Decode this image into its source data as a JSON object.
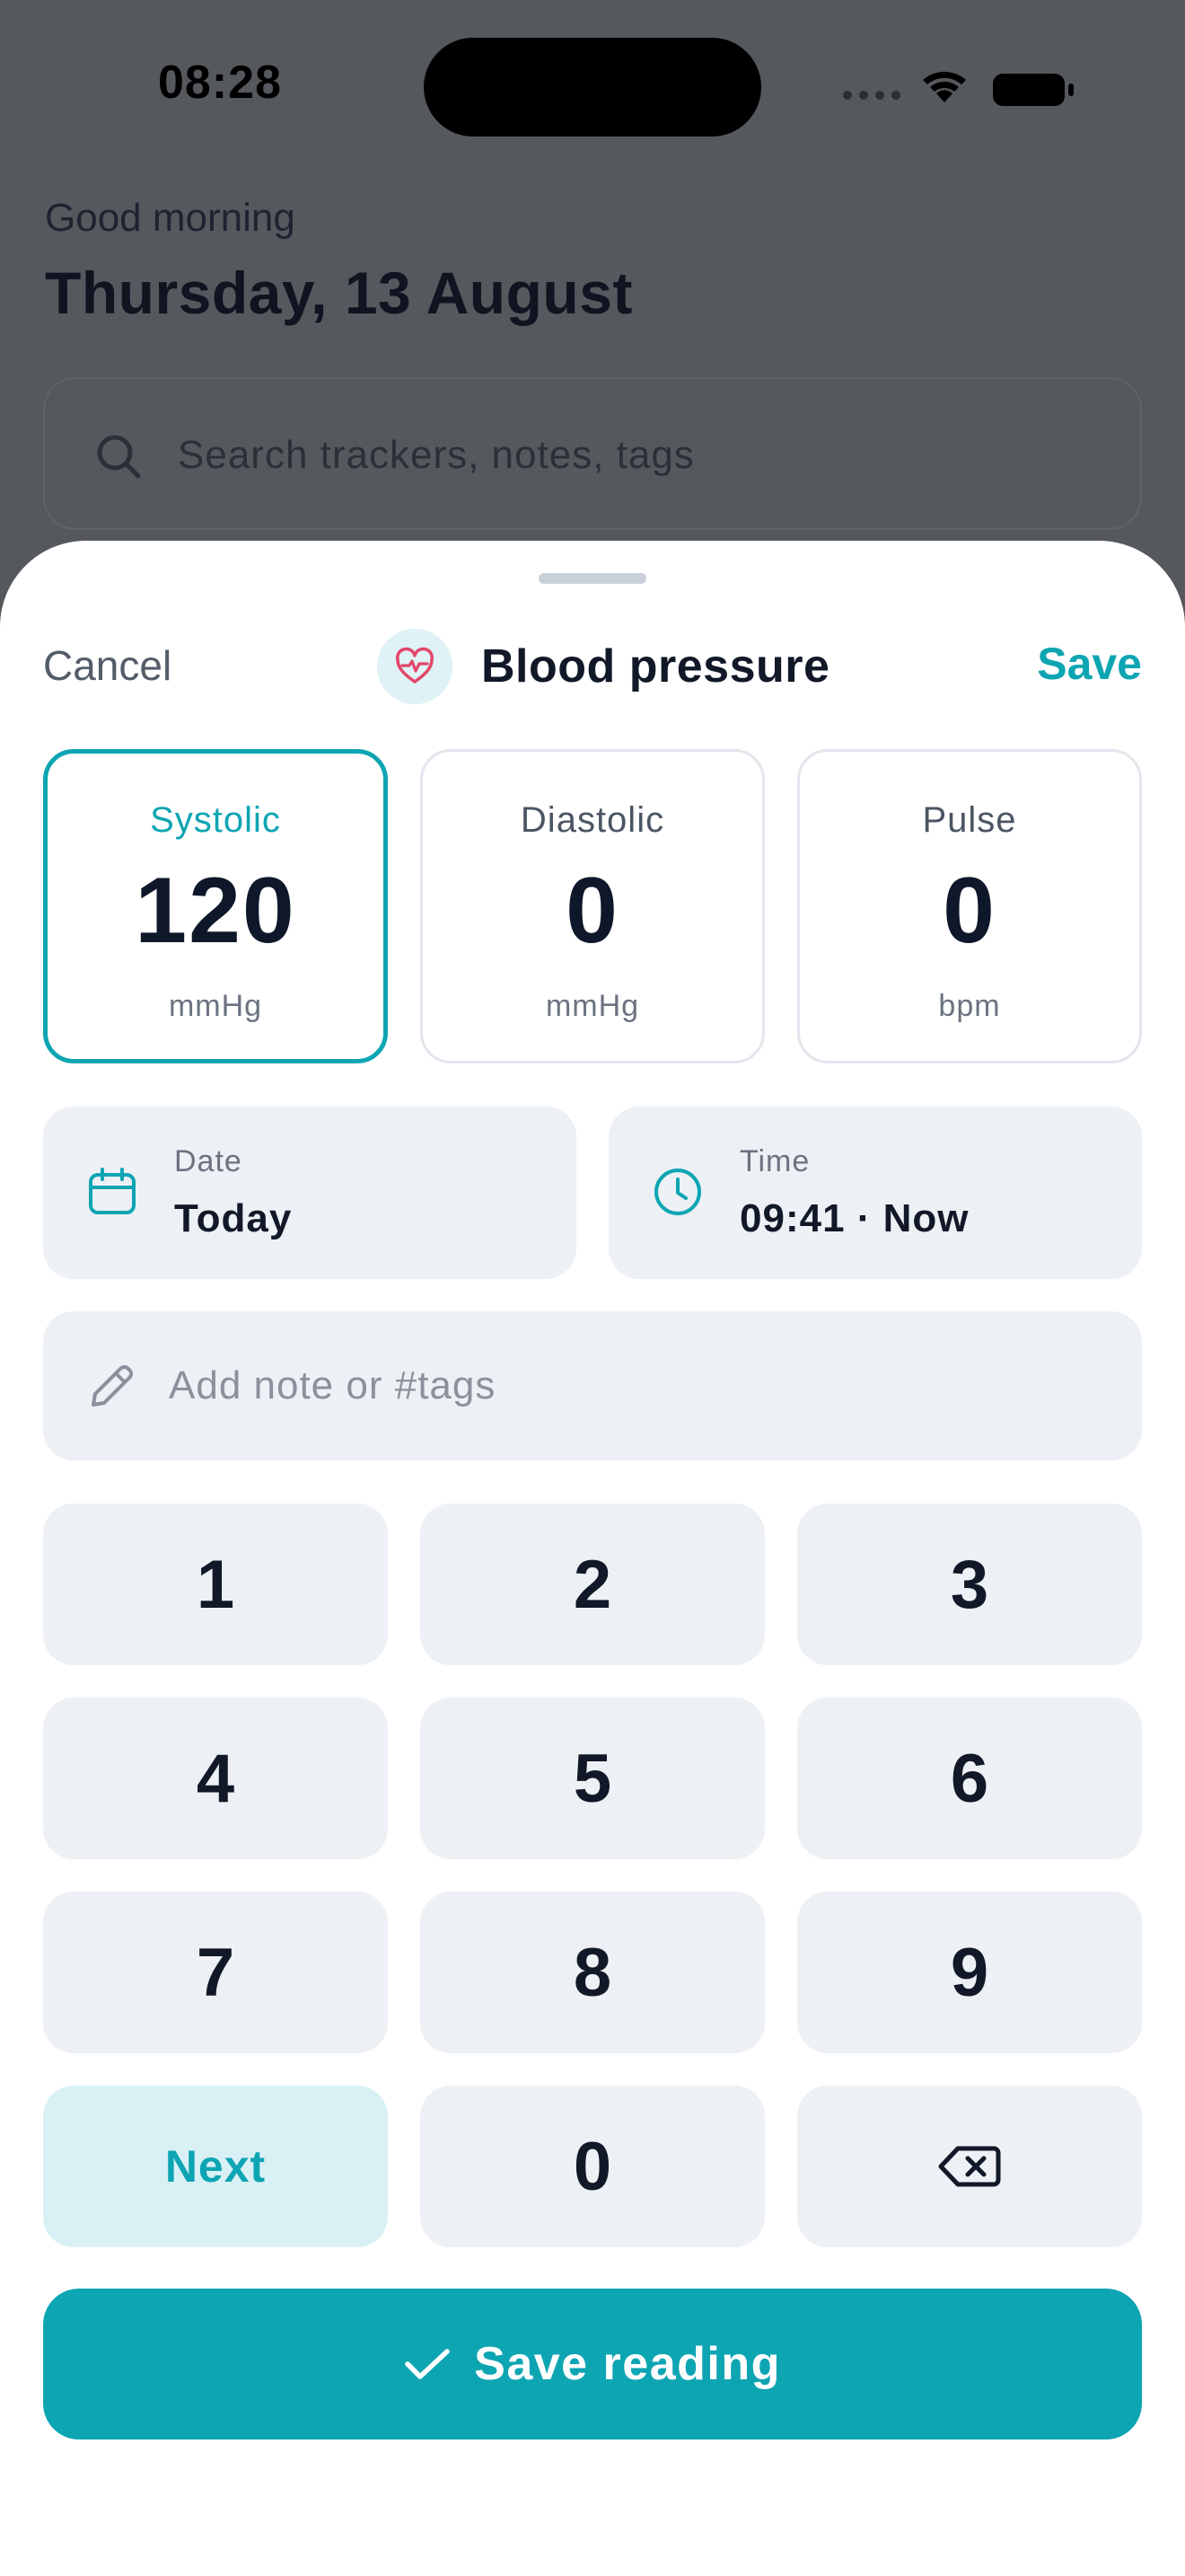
{
  "status_bar": {
    "time": "08:28"
  },
  "background": {
    "greeting": "Good morning",
    "date_title": "Thursday, 13 August",
    "search_placeholder": "Search trackers, notes, tags"
  },
  "sheet": {
    "cancel_label": "Cancel",
    "title": "Blood pressure",
    "title_icon": "heart-pulse-icon",
    "save_label": "Save",
    "metrics": [
      {
        "label": "Systolic",
        "value": "120",
        "unit": "mmHg",
        "active": true
      },
      {
        "label": "Diastolic",
        "value": "0",
        "unit": "mmHg",
        "active": false
      },
      {
        "label": "Pulse",
        "value": "0",
        "unit": "bpm",
        "active": false
      }
    ],
    "date": {
      "label": "Date",
      "value": "Today",
      "icon": "calendar-icon"
    },
    "time": {
      "label": "Time",
      "value": "09:41 · Now",
      "icon": "clock-icon"
    },
    "note_placeholder": "Add note or #tags",
    "keypad": [
      "1",
      "2",
      "3",
      "4",
      "5",
      "6",
      "7",
      "8",
      "9",
      "Next",
      "0",
      "backspace"
    ],
    "save_reading_label": "Save reading"
  },
  "colors": {
    "accent": "#0ea5b3",
    "accent_light": "#d9f1f5",
    "heart": "#e2466a",
    "key_bg": "#edf0f4",
    "overlay": "#55585d"
  }
}
